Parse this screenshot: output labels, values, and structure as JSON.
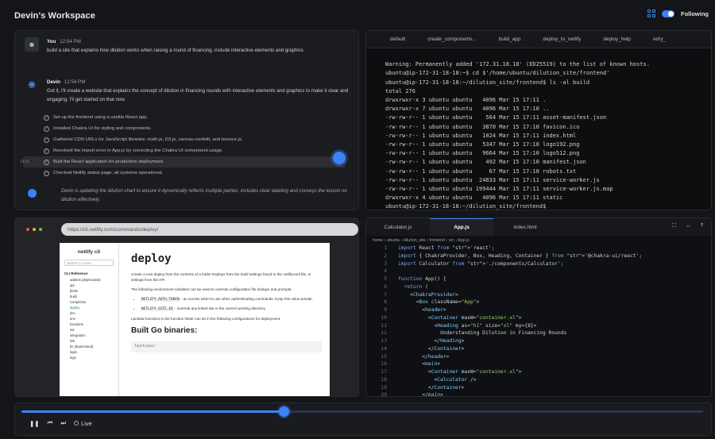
{
  "workspace": {
    "title": "Devin's Workspace",
    "follow_label": "Following"
  },
  "chat": {
    "user": {
      "name": "You",
      "time": "12:54 PM",
      "text": "build a site that explains how dilution works when raising a round of financing. include interactive elements and graphics"
    },
    "devin": {
      "name": "Devin",
      "time": "12:54 PM",
      "text": "Got it, I'll create a website that explains the concept of dilution in financing rounds with interactive elements and graphics to make it clear and engaging. I'll get started on that now."
    },
    "steps": [
      "Set up the frontend using a vanilla React app.",
      "Installed Chakra UI for styling and components.",
      "Gathered CDN URLs for JavaScript libraries: math.js, D3.js, canvas-confetti, and bounce.js.",
      "Resolved the import error in App.js by correcting the Chakra UI component usage.",
      "Built the React application for production deployment.",
      "Checked Netlify status page; all systems operational."
    ],
    "step_timestamp": "13:11",
    "status": "Devin is updating the dilution chart to ensure it dynamically reflects multiple parties, includes clear labeling and conveys the lesson on dilution effectively."
  },
  "terminal": {
    "tabs": [
      "default",
      "create_components...",
      "build_app",
      "deploy_to_netlify",
      "deploy_help",
      "retry_"
    ],
    "lines": [
      "Warning: Permanently added '172.31.18.18' (ED25519) to the list of known hosts.",
      "ubuntu@ip-172-31-18-18:~$ cd $'/home/ubuntu/dilution_site/frontend'",
      "ubuntu@ip-172-31-18-18:~/dilution_site/frontend$ ls -al build",
      "total 276",
      "drwxrwxr-x 3 ubuntu ubuntu   4096 Mar 15 17:11 .",
      "drwxrwxr-x 7 ubuntu ubuntu   4096 Mar 15 17:10 ..",
      "-rw-rw-r-- 1 ubuntu ubuntu    564 Mar 15 17:11 asset-manifest.json",
      "-rw-rw-r-- 1 ubuntu ubuntu   3870 Mar 15 17:10 favicon.ico",
      "-rw-rw-r-- 1 ubuntu ubuntu   1024 Mar 15 17:11 index.html",
      "-rw-rw-r-- 1 ubuntu ubuntu   5347 Mar 15 17:10 logo192.png",
      "-rw-rw-r-- 1 ubuntu ubuntu   9664 Mar 15 17:10 logo512.png",
      "-rw-rw-r-- 1 ubuntu ubuntu    492 Mar 15 17:10 manifest.json",
      "-rw-rw-r-- 1 ubuntu ubuntu     67 Mar 15 17:10 robots.txt",
      "-rw-rw-r-- 1 ubuntu ubuntu  24833 Mar 15 17:11 service-worker.js",
      "-rw-rw-r-- 1 ubuntu ubuntu 199444 Mar 15 17:11 service-worker.js.map",
      "drwxrwxr-x 4 ubuntu ubuntu   4096 Mar 15 17:11 static",
      "ubuntu@ip-172-31-18-18:~/dilution_site/frontend$"
    ]
  },
  "browser": {
    "url": "https://cli.netlify.com/commands/deploy/",
    "logo": "netlify cli",
    "search_placeholder": "Search CLI docs",
    "side_heading": "CLI Reference",
    "side_items": [
      "addons (deprecated)",
      "api",
      "blobs",
      "build",
      "completion",
      "deploy",
      "dev",
      "env",
      "functions",
      "init",
      "integration",
      "link",
      "lm (deprecated)",
      "login",
      "logs"
    ],
    "page_title": "deploy",
    "p1": "Create a new deploy from the contents of a folder Deploys from the build settings found in the netlify.toml file, or settings from the API.",
    "p2": "The following environment variables can be used to override configuration file lookups and prompts:",
    "env1_code": "NETLIFY_AUTH_TOKEN",
    "env1_text": " - an access token to use when authenticating commands. Keep this value private.",
    "env2_code": "NETLIFY_SITE_ID",
    "env2_text": " - override any linked site in the current working directory.",
    "p3": "Lambda functions in the function folder can be in the following configurations for deployment:",
    "h2": "Built Go binaries:",
    "pre": "functions/"
  },
  "editor": {
    "tabs": [
      "Calculator.js",
      "App.js",
      "index.html"
    ],
    "active_tab": "App.js",
    "breadcrumb": "home › ubuntu › dilution_site › frontend › src › App.js",
    "lines": [
      {
        "n": "1",
        "code": "import React from 'react';"
      },
      {
        "n": "2",
        "code": "import { ChakraProvider, Box, Heading, Container } from '@chakra-ui/react';"
      },
      {
        "n": "3",
        "code": "import Calculator from './components/Calculator';"
      },
      {
        "n": "4",
        "code": ""
      },
      {
        "n": "5",
        "code": "function App() {"
      },
      {
        "n": "6",
        "code": "  return ("
      },
      {
        "n": "7",
        "code": "    <ChakraProvider>"
      },
      {
        "n": "8",
        "code": "      <Box className=\"App\">"
      },
      {
        "n": "9",
        "code": "        <header>"
      },
      {
        "n": "10",
        "code": "          <Container maxW=\"container.xl\">"
      },
      {
        "n": "11",
        "code": "            <Heading as=\"h1\" size=\"xl\" my={8}>"
      },
      {
        "n": "12",
        "code": "              Understanding Dilution in Financing Rounds"
      },
      {
        "n": "13",
        "code": "            </Heading>"
      },
      {
        "n": "14",
        "code": "          </Container>"
      },
      {
        "n": "15",
        "code": "        </header>"
      },
      {
        "n": "16",
        "code": "        <main>"
      },
      {
        "n": "17",
        "code": "          <Container maxW=\"container.xl\">"
      },
      {
        "n": "18",
        "code": "            <Calculator />"
      },
      {
        "n": "19",
        "code": "          </Container>"
      },
      {
        "n": "20",
        "code": "        </main>"
      }
    ]
  },
  "playback": {
    "live_label": "Live",
    "progress": 0.385
  },
  "colors": {
    "accent": "#3b82f6",
    "background": "#141518",
    "terminal_bg": "#0d0e10"
  }
}
